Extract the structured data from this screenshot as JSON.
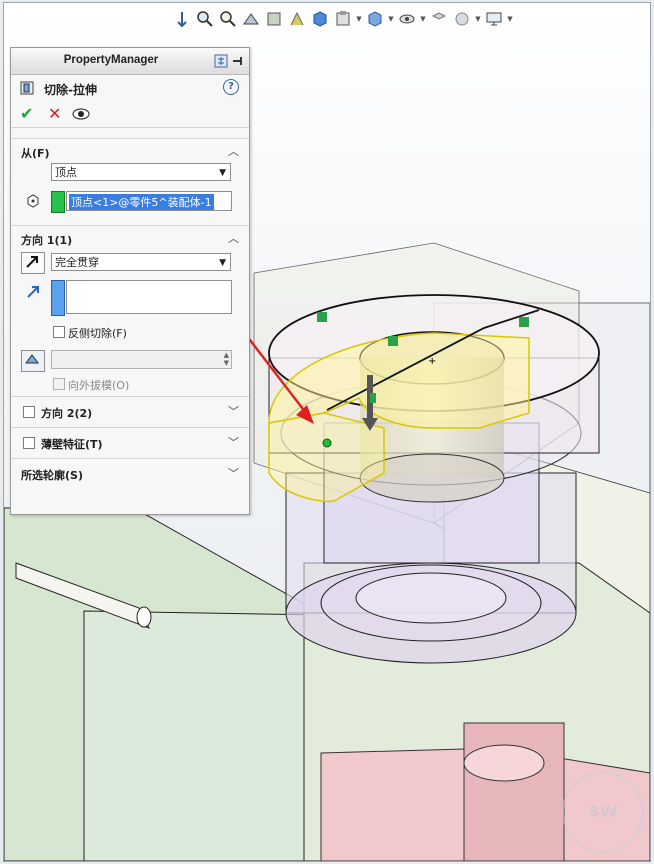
{
  "property_manager": {
    "title": "PropertyManager",
    "feature_name": "切除-拉伸",
    "help_symbol": "?",
    "ok_symbol": "✔",
    "cancel_symbol": "✕",
    "from_section": {
      "label": "从(F)",
      "start_condition": "顶点",
      "selected_entity": "顶点<1>@零件5^装配体-1"
    },
    "direction1_section": {
      "label": "方向 1(1)",
      "end_condition": "完全贯穿",
      "flip_side_to_cut_label": "反侧切除(F)",
      "flip_side_to_cut_checked": false,
      "draft_outward_label": "向外拔模(O)",
      "draft_outward_checked": false
    },
    "direction2_section": {
      "label": "方向 2(2)",
      "checked": false
    },
    "thin_feature_section": {
      "label": "薄壁特征(T)",
      "checked": false
    },
    "selected_contours_section": {
      "label": "所选轮廓(S)"
    }
  },
  "watermark": "SW"
}
